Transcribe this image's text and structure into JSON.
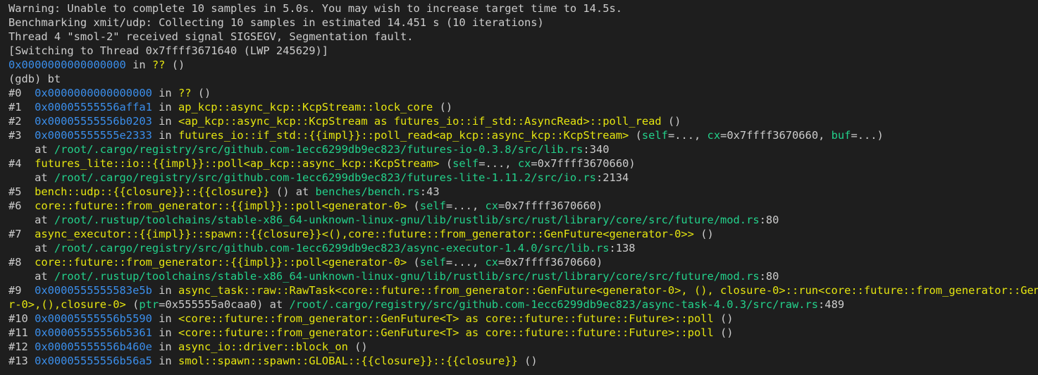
{
  "colors": {
    "background": "#1e1e1e",
    "default_text": "#cccccc",
    "address": "#3b8eea",
    "function": "#e5e510",
    "argument": "#23d18b",
    "file_path": "#23d18b"
  },
  "terminal": {
    "lines": [
      [
        {
          "t": "Warning: Unable to complete 10 samples in 5.0s. You may wish to increase target time to 14.5s.",
          "c": "default_text"
        }
      ],
      [
        {
          "t": "Benchmarking xmit/udp: Collecting 10 samples in estimated 14.451 s (10 iterations)",
          "c": "default_text"
        }
      ],
      [
        {
          "t": "Thread 4 \"smol-2\" received signal SIGSEGV, Segmentation fault.",
          "c": "default_text"
        }
      ],
      [
        {
          "t": "[Switching to Thread 0x7ffff3671640 (LWP 245629)]",
          "c": "default_text"
        }
      ],
      [
        {
          "t": "0x0000000000000000",
          "c": "address"
        },
        {
          "t": " in ",
          "c": "default_text"
        },
        {
          "t": "??",
          "c": "function"
        },
        {
          "t": " ()",
          "c": "default_text"
        }
      ],
      [
        {
          "t": "(gdb) bt",
          "c": "default_text"
        }
      ],
      [
        {
          "t": "#0  ",
          "c": "default_text"
        },
        {
          "t": "0x0000000000000000",
          "c": "address"
        },
        {
          "t": " in ",
          "c": "default_text"
        },
        {
          "t": "??",
          "c": "function"
        },
        {
          "t": " ()",
          "c": "default_text"
        }
      ],
      [
        {
          "t": "#1  ",
          "c": "default_text"
        },
        {
          "t": "0x00005555556affa1",
          "c": "address"
        },
        {
          "t": " in ",
          "c": "default_text"
        },
        {
          "t": "ap_kcp::async_kcp::KcpStream::lock_core",
          "c": "function"
        },
        {
          "t": " ()",
          "c": "default_text"
        }
      ],
      [
        {
          "t": "#2  ",
          "c": "default_text"
        },
        {
          "t": "0x00005555556b0203",
          "c": "address"
        },
        {
          "t": " in ",
          "c": "default_text"
        },
        {
          "t": "<ap_kcp::async_kcp::KcpStream as futures_io::if_std::AsyncRead>::poll_read",
          "c": "function"
        },
        {
          "t": " ()",
          "c": "default_text"
        }
      ],
      [
        {
          "t": "#3  ",
          "c": "default_text"
        },
        {
          "t": "0x00005555555e2333",
          "c": "address"
        },
        {
          "t": " in ",
          "c": "default_text"
        },
        {
          "t": "futures_io::if_std::{{impl}}::poll_read<ap_kcp::async_kcp::KcpStream>",
          "c": "function"
        },
        {
          "t": " (",
          "c": "default_text"
        },
        {
          "t": "self",
          "c": "argument"
        },
        {
          "t": "=..., ",
          "c": "default_text"
        },
        {
          "t": "cx",
          "c": "argument"
        },
        {
          "t": "=0x7ffff3670660, ",
          "c": "default_text"
        },
        {
          "t": "buf",
          "c": "argument"
        },
        {
          "t": "=...)",
          "c": "default_text"
        }
      ],
      [
        {
          "t": "    at ",
          "c": "default_text"
        },
        {
          "t": "/root/.cargo/registry/src/github.com-1ecc6299db9ec823/futures-io-0.3.8/src/lib.rs",
          "c": "file_path"
        },
        {
          "t": ":340",
          "c": "default_text"
        }
      ],
      [
        {
          "t": "#4  ",
          "c": "default_text"
        },
        {
          "t": "futures_lite::io::{{impl}}::poll<ap_kcp::async_kcp::KcpStream>",
          "c": "function"
        },
        {
          "t": " (",
          "c": "default_text"
        },
        {
          "t": "self",
          "c": "argument"
        },
        {
          "t": "=..., ",
          "c": "default_text"
        },
        {
          "t": "cx",
          "c": "argument"
        },
        {
          "t": "=0x7ffff3670660)",
          "c": "default_text"
        }
      ],
      [
        {
          "t": "    at ",
          "c": "default_text"
        },
        {
          "t": "/root/.cargo/registry/src/github.com-1ecc6299db9ec823/futures-lite-1.11.2/src/io.rs",
          "c": "file_path"
        },
        {
          "t": ":2134",
          "c": "default_text"
        }
      ],
      [
        {
          "t": "#5  ",
          "c": "default_text"
        },
        {
          "t": "bench::udp::{{closure}}::{{closure}}",
          "c": "function"
        },
        {
          "t": " () at ",
          "c": "default_text"
        },
        {
          "t": "benches/bench.rs",
          "c": "file_path"
        },
        {
          "t": ":43",
          "c": "default_text"
        }
      ],
      [
        {
          "t": "#6  ",
          "c": "default_text"
        },
        {
          "t": "core::future::from_generator::{{impl}}::poll<generator-0>",
          "c": "function"
        },
        {
          "t": " (",
          "c": "default_text"
        },
        {
          "t": "self",
          "c": "argument"
        },
        {
          "t": "=..., ",
          "c": "default_text"
        },
        {
          "t": "cx",
          "c": "argument"
        },
        {
          "t": "=0x7ffff3670660)",
          "c": "default_text"
        }
      ],
      [
        {
          "t": "    at ",
          "c": "default_text"
        },
        {
          "t": "/root/.rustup/toolchains/stable-x86_64-unknown-linux-gnu/lib/rustlib/src/rust/library/core/src/future/mod.rs",
          "c": "file_path"
        },
        {
          "t": ":80",
          "c": "default_text"
        }
      ],
      [
        {
          "t": "#7  ",
          "c": "default_text"
        },
        {
          "t": "async_executor::{{impl}}::spawn::{{closure}}<(),core::future::from_generator::GenFuture<generator-0>>",
          "c": "function"
        },
        {
          "t": " ()",
          "c": "default_text"
        }
      ],
      [
        {
          "t": "    at ",
          "c": "default_text"
        },
        {
          "t": "/root/.cargo/registry/src/github.com-1ecc6299db9ec823/async-executor-1.4.0/src/lib.rs",
          "c": "file_path"
        },
        {
          "t": ":138",
          "c": "default_text"
        }
      ],
      [
        {
          "t": "#8  ",
          "c": "default_text"
        },
        {
          "t": "core::future::from_generator::{{impl}}::poll<generator-0>",
          "c": "function"
        },
        {
          "t": " (",
          "c": "default_text"
        },
        {
          "t": "self",
          "c": "argument"
        },
        {
          "t": "=..., ",
          "c": "default_text"
        },
        {
          "t": "cx",
          "c": "argument"
        },
        {
          "t": "=0x7ffff3670660)",
          "c": "default_text"
        }
      ],
      [
        {
          "t": "    at ",
          "c": "default_text"
        },
        {
          "t": "/root/.rustup/toolchains/stable-x86_64-unknown-linux-gnu/lib/rustlib/src/rust/library/core/src/future/mod.rs",
          "c": "file_path"
        },
        {
          "t": ":80",
          "c": "default_text"
        }
      ],
      [
        {
          "t": "#9  ",
          "c": "default_text"
        },
        {
          "t": "0x0000555555583e5b",
          "c": "address"
        },
        {
          "t": " in ",
          "c": "default_text"
        },
        {
          "t": "async_task::raw::RawTask<core::future::from_generator::GenFuture<generator-0>, (), closure-0>::run<core::future::from_generator::GenFutu",
          "c": "function"
        }
      ],
      [
        {
          "t": "r-0>,(),closure-0>",
          "c": "function"
        },
        {
          "t": " (",
          "c": "default_text"
        },
        {
          "t": "ptr",
          "c": "argument"
        },
        {
          "t": "=0x555555a0caa0) at ",
          "c": "default_text"
        },
        {
          "t": "/root/.cargo/registry/src/github.com-1ecc6299db9ec823/async-task-4.0.3/src/raw.rs",
          "c": "file_path"
        },
        {
          "t": ":489",
          "c": "default_text"
        }
      ],
      [
        {
          "t": "#10 ",
          "c": "default_text"
        },
        {
          "t": "0x00005555556b5590",
          "c": "address"
        },
        {
          "t": " in ",
          "c": "default_text"
        },
        {
          "t": "<core::future::from_generator::GenFuture<T> as core::future::future::Future>::poll",
          "c": "function"
        },
        {
          "t": " ()",
          "c": "default_text"
        }
      ],
      [
        {
          "t": "#11 ",
          "c": "default_text"
        },
        {
          "t": "0x00005555556b5361",
          "c": "address"
        },
        {
          "t": " in ",
          "c": "default_text"
        },
        {
          "t": "<core::future::from_generator::GenFuture<T> as core::future::future::Future>::poll",
          "c": "function"
        },
        {
          "t": " ()",
          "c": "default_text"
        }
      ],
      [
        {
          "t": "#12 ",
          "c": "default_text"
        },
        {
          "t": "0x00005555556b460e",
          "c": "address"
        },
        {
          "t": " in ",
          "c": "default_text"
        },
        {
          "t": "async_io::driver::block_on",
          "c": "function"
        },
        {
          "t": " ()",
          "c": "default_text"
        }
      ],
      [
        {
          "t": "#13 ",
          "c": "default_text"
        },
        {
          "t": "0x00005555556b56a5",
          "c": "address"
        },
        {
          "t": " in ",
          "c": "default_text"
        },
        {
          "t": "smol::spawn::spawn::GLOBAL::{{closure}}::{{closure}}",
          "c": "function"
        },
        {
          "t": " ()",
          "c": "default_text"
        }
      ]
    ]
  }
}
